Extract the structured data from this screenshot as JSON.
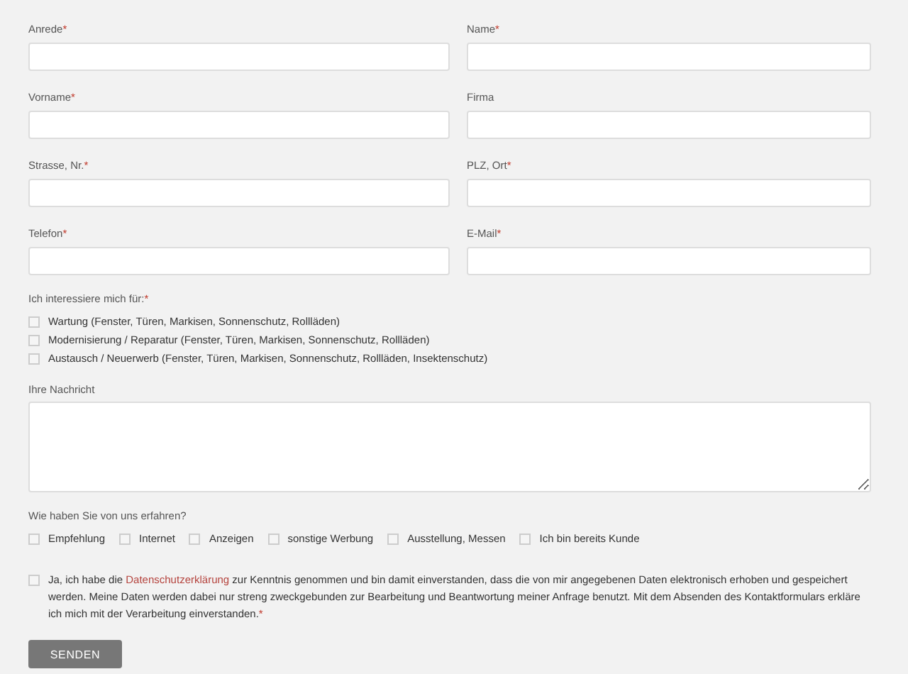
{
  "fields": [
    {
      "label": "Anrede",
      "required_mark": "*"
    },
    {
      "label": "Name",
      "required_mark": "*"
    },
    {
      "label": "Vorname",
      "required_mark": "*"
    },
    {
      "label": "Firma"
    },
    {
      "label": "Strasse, Nr.",
      "required_mark": "*"
    },
    {
      "label": "PLZ, Ort",
      "required_mark": "*"
    },
    {
      "label": "Telefon",
      "required_mark": "*"
    },
    {
      "label": "E-Mail",
      "required_mark": "*"
    }
  ],
  "interests": {
    "label": "Ich interessiere mich für:",
    "required_mark": "*",
    "options": [
      {
        "label": "Wartung (Fenster, Türen, Markisen, Sonnenschutz, Rollläden)",
        "checked": false
      },
      {
        "label": "Modernisierung / Reparatur (Fenster, Türen, Markisen, Sonnenschutz, Rollläden)",
        "checked": false
      },
      {
        "label": "Austausch / Neuerwerb (Fenster, Türen, Markisen, Sonnenschutz, Rollläden, Insektenschutz)",
        "checked": false
      }
    ]
  },
  "message": {
    "label": "Ihre Nachricht"
  },
  "source": {
    "label": "Wie haben Sie von uns erfahren?",
    "options": [
      {
        "label": "Empfehlung",
        "checked": false
      },
      {
        "label": "Internet",
        "checked": false
      },
      {
        "label": "Anzeigen",
        "checked": false
      },
      {
        "label": "sonstige Werbung",
        "checked": false
      },
      {
        "label": "Ausstellung, Messen",
        "checked": false
      },
      {
        "label": "Ich bin bereits Kunde",
        "checked": false
      }
    ]
  },
  "consent": {
    "checked": false,
    "text_before": "Ja, ich habe die",
    "link": "Datenschutzerklärung",
    "text_after": "zur Kenntnis genommen und bin damit einverstanden, dass die von mir angegebenen Daten elektronisch erhoben und gespeichert werden. Meine Daten werden dabei nur streng zweckgebunden zur Bearbeitung und Beantwortung meiner Anfrage benutzt. Mit dem Absenden des Kontaktformulars erkläre ich mich mit der Verarbeitung einverstanden.",
    "required_mark": "*"
  },
  "submit": "SENDEN"
}
